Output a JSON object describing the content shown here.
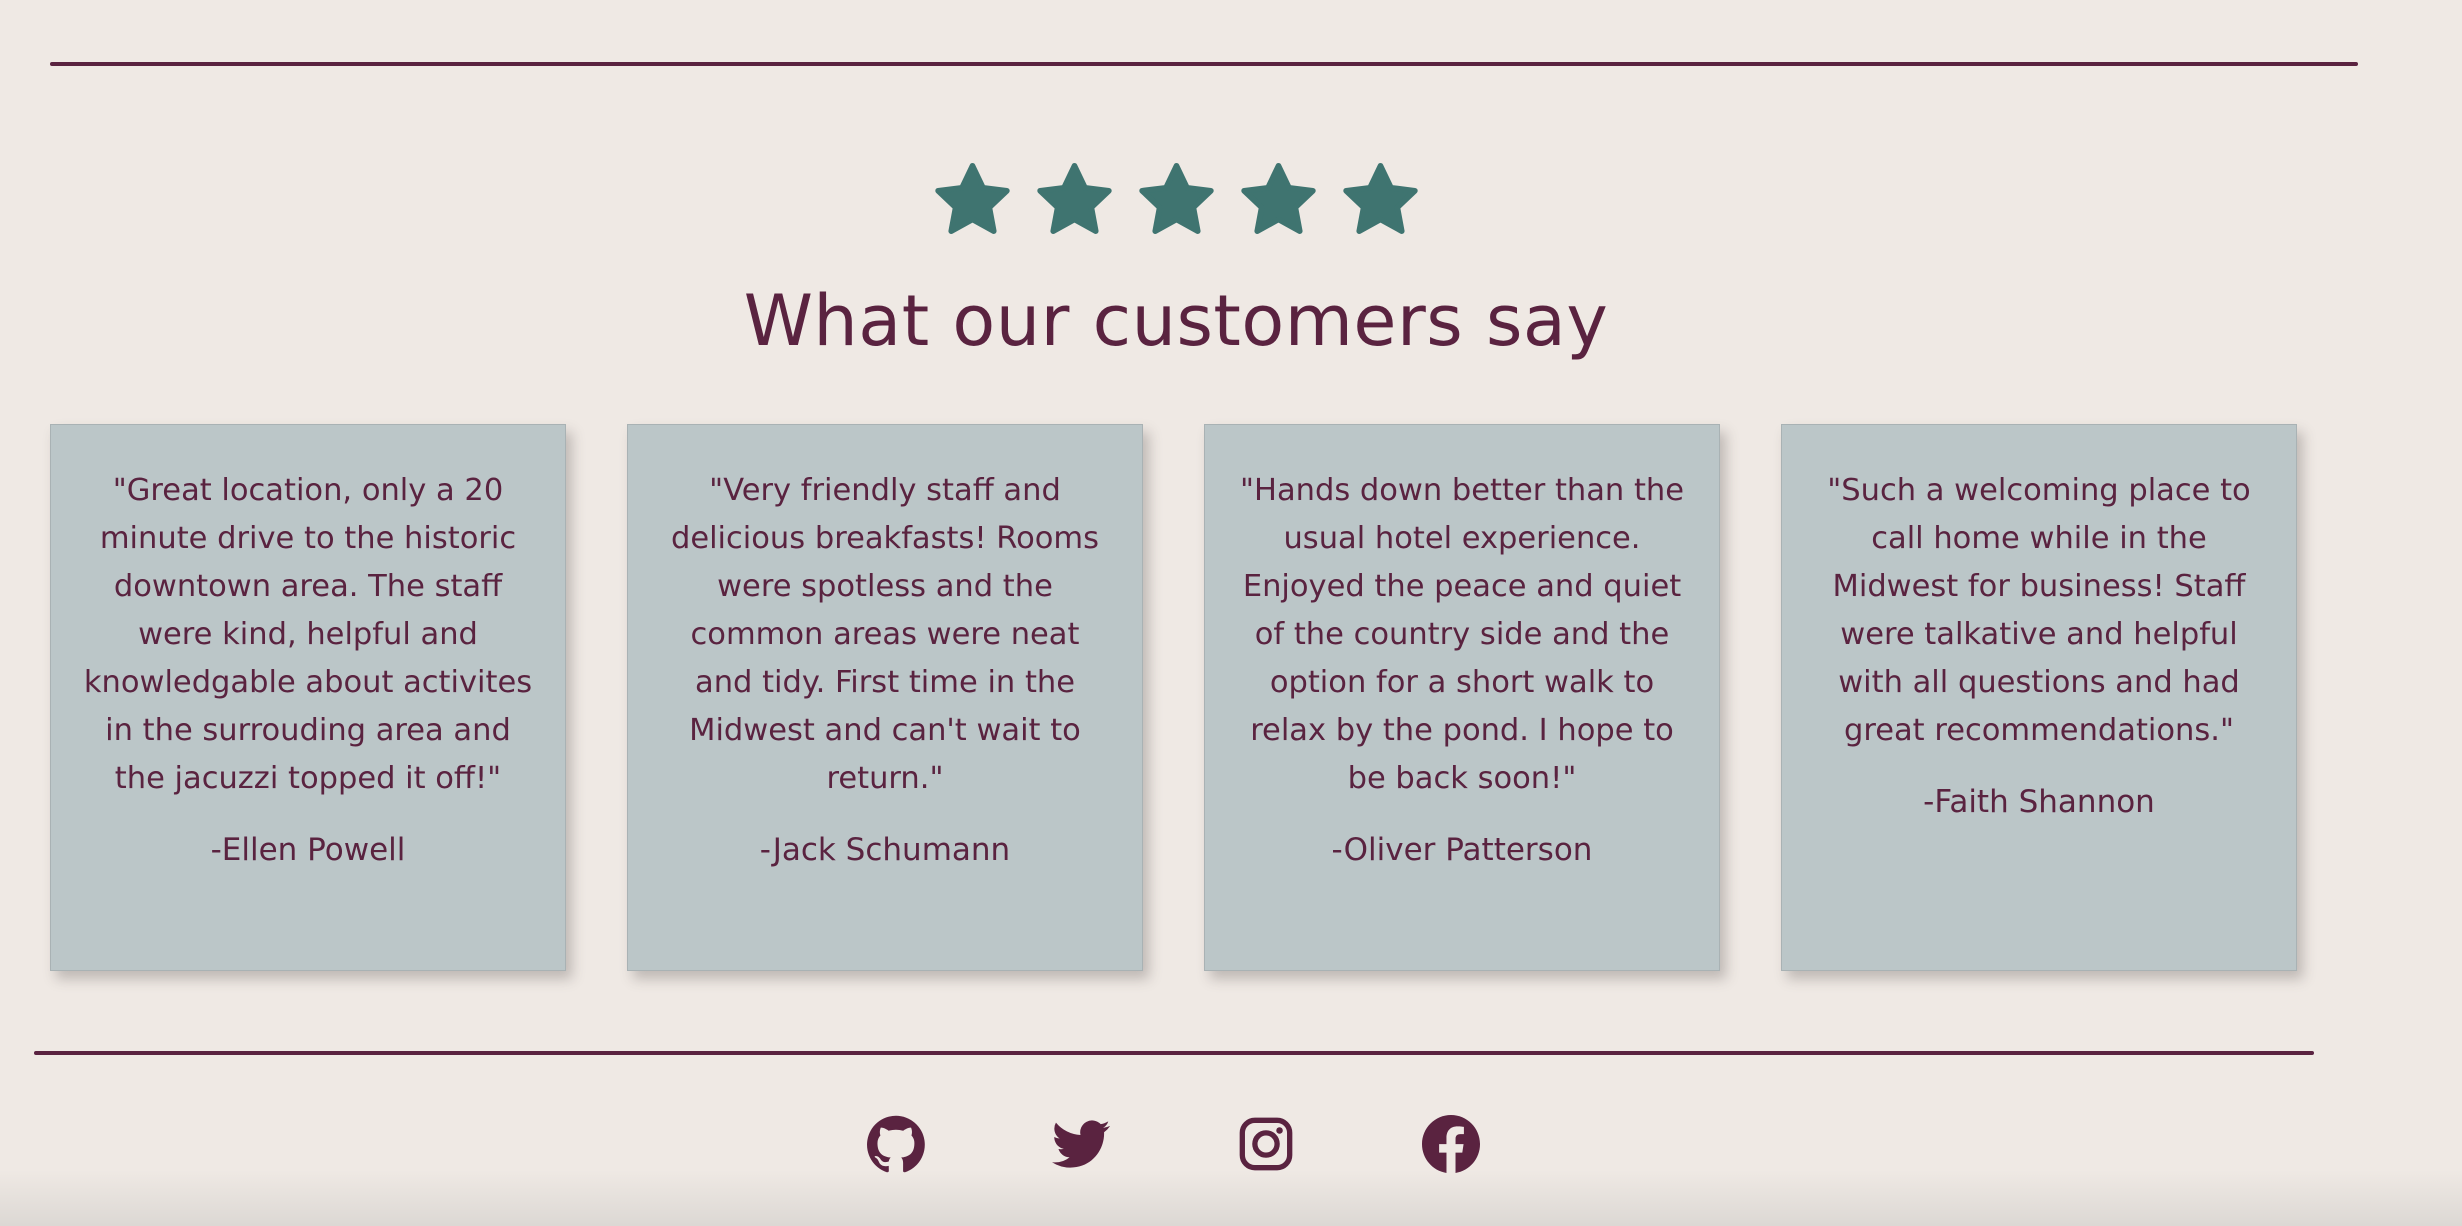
{
  "colors": {
    "background": "#efe9e4",
    "accent": "#5a2340",
    "star": "#3f7470",
    "card": "#bbc6c8"
  },
  "rating": {
    "value": 5,
    "max": 5
  },
  "section": {
    "title": "What our customers say"
  },
  "testimonials": [
    {
      "quote": "\"Great location, only a 20 minute drive to the historic downtown area. The staff were kind, helpful and knowledgable about activites in the surrouding area and the jacuzzi topped it off!\"",
      "author": "-Ellen Powell"
    },
    {
      "quote": "\"Very friendly staff and delicious breakfasts! Rooms were spotless and the common areas were neat and tidy. First time in the Midwest and can't wait to return.\"",
      "author": "-Jack Schumann"
    },
    {
      "quote": "\"Hands down better than the usual hotel experience. Enjoyed the peace and quiet of the country side and the option for a short walk to relax by the pond. I hope to be back soon!\"",
      "author": "-Oliver Patterson"
    },
    {
      "quote": "\"Such a welcoming place to call home while in the Midwest for business! Staff were talkative and helpful with all questions and had great recommendations.\"",
      "author": "-Faith Shannon"
    }
  ],
  "footer": {
    "icons": [
      "github-icon",
      "twitter-icon",
      "instagram-icon",
      "facebook-icon"
    ]
  }
}
